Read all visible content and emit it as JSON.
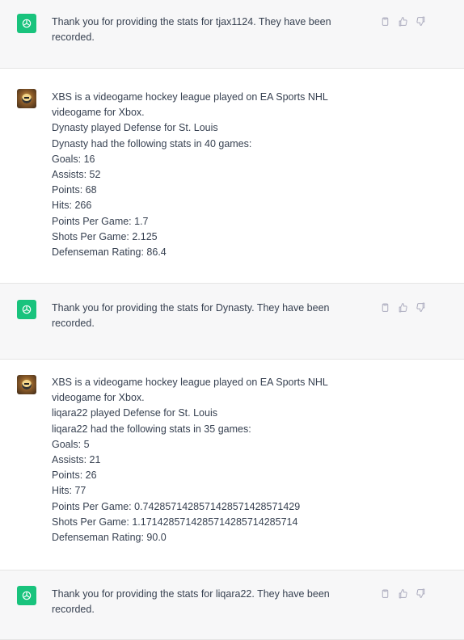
{
  "conversation": {
    "m1": {
      "role": "assistant",
      "lines": [
        "Thank you for providing the stats for tjax1124. They have been",
        "recorded."
      ]
    },
    "m2": {
      "role": "user",
      "lines": [
        "XBS is a videogame hockey league played on EA Sports NHL",
        "videogame for Xbox.",
        "Dynasty played Defense for St. Louis",
        "Dynasty had the following stats in 40 games:",
        "Goals: 16",
        "Assists: 52",
        "Points: 68",
        "Hits: 266",
        "Points Per Game: 1.7",
        "Shots Per Game: 2.125",
        "Defenseman Rating: 86.4"
      ]
    },
    "m3": {
      "role": "assistant",
      "lines": [
        "Thank you for providing the stats for Dynasty. They have been",
        "recorded."
      ]
    },
    "m4": {
      "role": "user",
      "lines": [
        "XBS is a videogame hockey league played on EA Sports NHL",
        "videogame for Xbox.",
        "liqara22 played Defense for St. Louis",
        "liqara22 had the following stats in 35 games:",
        "Goals: 5",
        "Assists: 21",
        "Points: 26",
        "Hits: 77",
        "Points Per Game: 0.7428571428571428571428571429",
        "Shots Per Game: 1.1714285714285714285714285714",
        "Defenseman Rating: 90.0"
      ]
    },
    "m5": {
      "role": "assistant",
      "lines": [
        "Thank you for providing the stats for liqara22. They have been",
        "recorded."
      ]
    }
  },
  "icons": {
    "assistant_avatar": "openai-logo-icon",
    "user_avatar": "user-avatar-icon",
    "copy": "clipboard-icon",
    "thumbs_up": "thumbs-up-icon",
    "thumbs_down": "thumbs-down-icon"
  },
  "colors": {
    "assistant_bg": "#f7f7f8",
    "user_bg": "#ffffff",
    "accent": "#19c37d",
    "text": "#374151",
    "icon": "#acacbe"
  }
}
